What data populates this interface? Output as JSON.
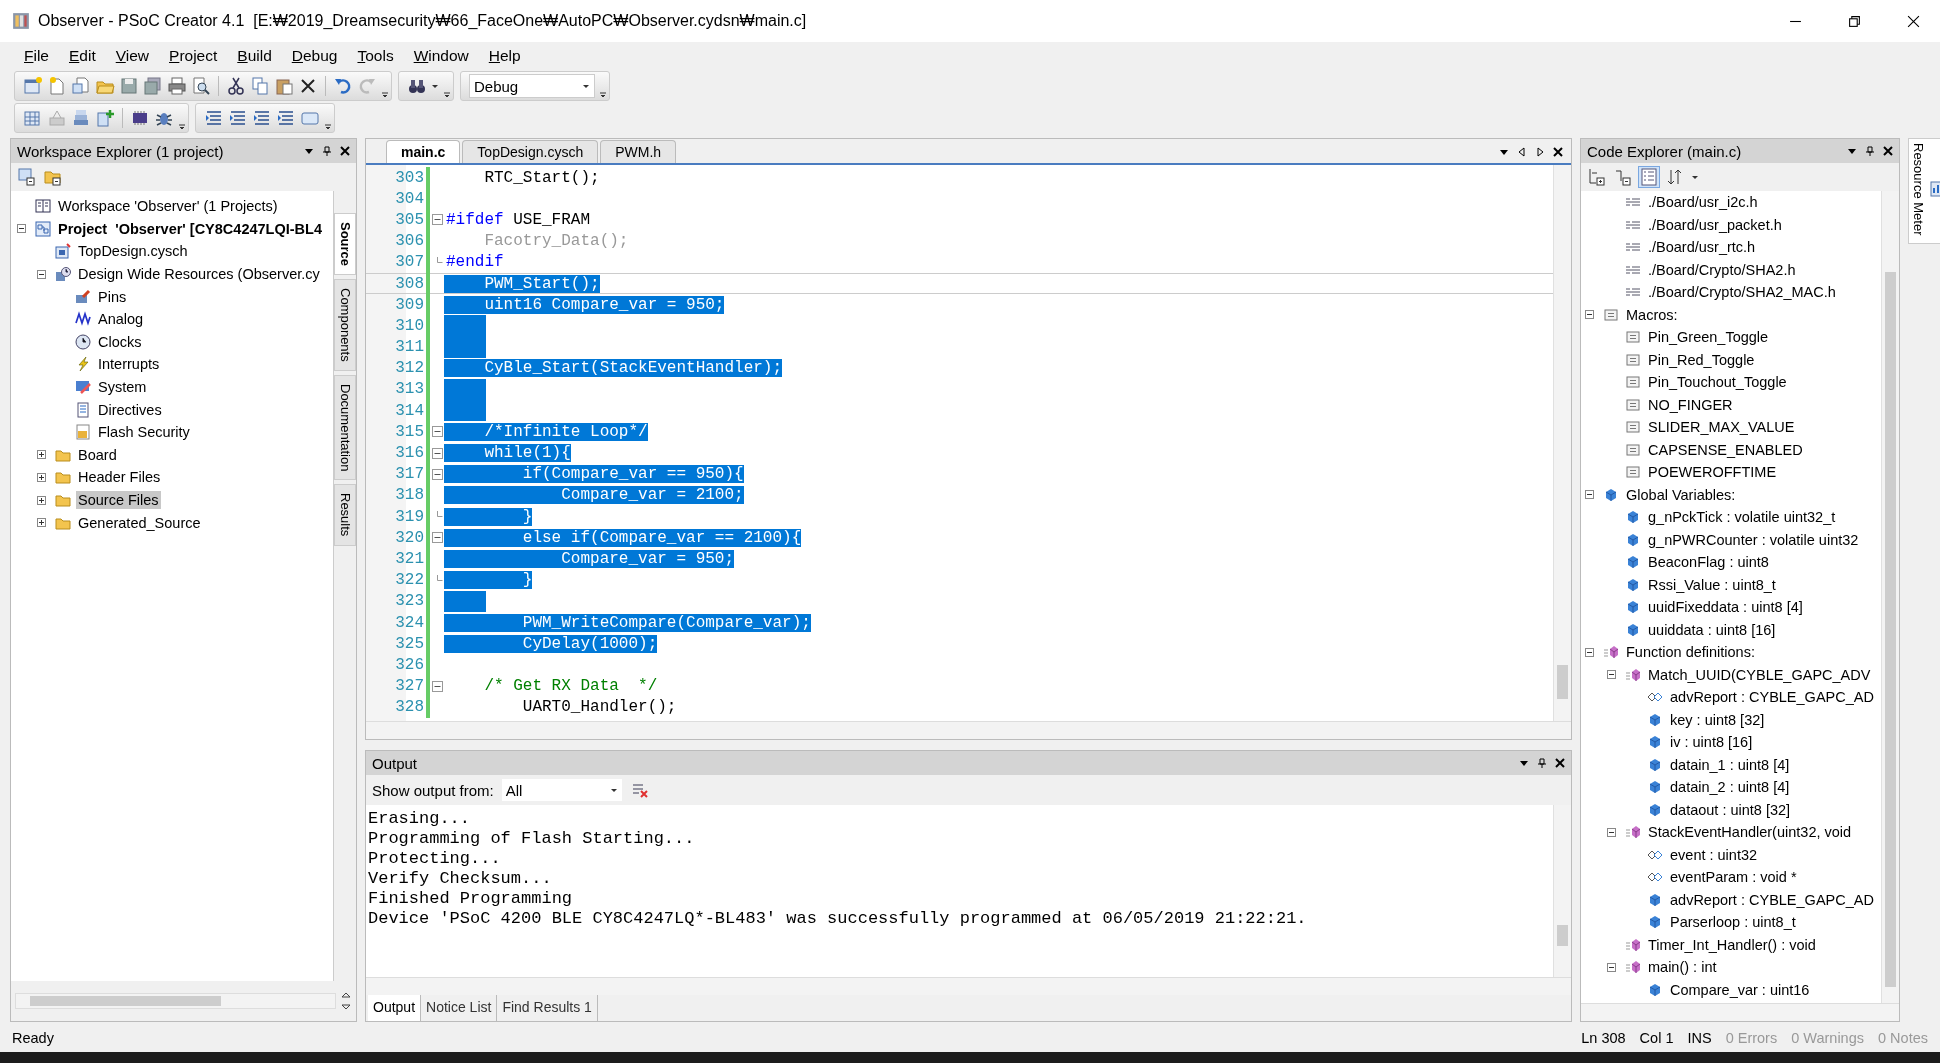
{
  "window": {
    "title": "Observer - PSoC Creator 4.1  [E:₩2019_Dreamsecurity₩66_FaceOne₩AutoPC₩Observer.cydsn₩main.c]"
  },
  "menu": [
    "File",
    "Edit",
    "View",
    "Project",
    "Build",
    "Debug",
    "Tools",
    "Window",
    "Help"
  ],
  "toolbar": {
    "configuration": "Debug"
  },
  "workspace_explorer": {
    "title": "Workspace Explorer (1 project)",
    "tree": [
      {
        "label": "Workspace 'Observer' (1 Projects)",
        "kind": "workspace",
        "selected": false
      },
      {
        "label": "Project  'Observer' [CY8C4247LQI-BL4",
        "kind": "project",
        "expanded": true,
        "selected": false,
        "children": [
          {
            "label": "TopDesign.cysch",
            "kind": "schematic",
            "selected": false
          },
          {
            "label": "Design Wide Resources (Observer.cy",
            "kind": "resources",
            "expanded": true,
            "selected": false,
            "children": [
              {
                "label": "Pins",
                "kind": "pins",
                "selected": false
              },
              {
                "label": "Analog",
                "kind": "analog",
                "selected": false
              },
              {
                "label": "Clocks",
                "kind": "clocks",
                "selected": false
              },
              {
                "label": "Interrupts",
                "kind": "interrupts",
                "selected": false
              },
              {
                "label": "System",
                "kind": "system",
                "selected": false
              },
              {
                "label": "Directives",
                "kind": "directives",
                "selected": false
              },
              {
                "label": "Flash Security",
                "kind": "security",
                "selected": false
              }
            ]
          },
          {
            "label": "Board",
            "kind": "folder",
            "expanded": false,
            "selected": false
          },
          {
            "label": "Header Files",
            "kind": "folder",
            "expanded": false,
            "selected": false
          },
          {
            "label": "Source Files",
            "kind": "folder",
            "expanded": false,
            "selected": true
          },
          {
            "label": "Generated_Source",
            "kind": "folder",
            "expanded": false,
            "selected": false
          }
        ]
      }
    ],
    "side_tabs": [
      {
        "label": "Source",
        "selected": true
      },
      {
        "label": "Components",
        "selected": false
      },
      {
        "label": "Documentation",
        "selected": false
      },
      {
        "label": "Results",
        "selected": false
      }
    ]
  },
  "editor": {
    "tabs": [
      {
        "label": "main.c",
        "selected": true
      },
      {
        "label": "TopDesign.cysch",
        "selected": false
      },
      {
        "label": "PWM.h",
        "selected": false
      }
    ],
    "lines": [
      {
        "num": "303",
        "kind": "code",
        "text": "    RTC_Start();",
        "collapsible": false,
        "block_end": false,
        "selected": false,
        "current": false
      },
      {
        "num": "304",
        "kind": "code",
        "collapsible": false,
        "block_end": false,
        "selected": false,
        "current": false
      },
      {
        "num": "305",
        "kind": "preproc",
        "directive": "#ifdef",
        "text": " USE_FRAM",
        "collapsible": true,
        "block_end": false,
        "selected": false,
        "current": false
      },
      {
        "num": "306",
        "kind": "inactive",
        "text": "    Facotry_Data();",
        "collapsible": false,
        "block_end": false,
        "selected": false,
        "current": false
      },
      {
        "num": "307",
        "kind": "preproc",
        "directive": "#endif",
        "collapsible": false,
        "block_end": true,
        "selected": false,
        "current": false
      },
      {
        "num": "308",
        "kind": "code",
        "text": "    PWM_Start();",
        "collapsible": false,
        "block_end": false,
        "selected": true,
        "current": true
      },
      {
        "num": "309",
        "kind": "code",
        "text": "    uint16 Compare_var = 950;",
        "collapsible": false,
        "block_end": false,
        "selected": true,
        "current": false
      },
      {
        "num": "310",
        "kind": "code",
        "collapsible": false,
        "block_end": false,
        "selected": true,
        "current": false
      },
      {
        "num": "311",
        "kind": "code",
        "collapsible": false,
        "block_end": false,
        "selected": true,
        "current": false
      },
      {
        "num": "312",
        "kind": "code",
        "text": "    CyBle_Start(StackEventHandler);",
        "collapsible": false,
        "block_end": false,
        "selected": true,
        "current": false
      },
      {
        "num": "313",
        "kind": "code",
        "collapsible": false,
        "block_end": false,
        "selected": true,
        "current": false
      },
      {
        "num": "314",
        "kind": "code",
        "collapsible": false,
        "block_end": false,
        "selected": true,
        "current": false
      },
      {
        "num": "315",
        "kind": "comment",
        "text": "    /*Infinite Loop*/",
        "collapsible": true,
        "block_end": false,
        "selected": true,
        "current": false
      },
      {
        "num": "316",
        "kind": "code",
        "text": "    while(1){",
        "collapsible": true,
        "block_end": false,
        "selected": true,
        "current": false
      },
      {
        "num": "317",
        "kind": "code",
        "text": "        if(Compare_var == 950){",
        "collapsible": true,
        "block_end": false,
        "selected": true,
        "current": false
      },
      {
        "num": "318",
        "kind": "code",
        "text": "            Compare_var = 2100;",
        "collapsible": false,
        "block_end": false,
        "selected": true,
        "current": false
      },
      {
        "num": "319",
        "kind": "code",
        "text": "        }",
        "collapsible": false,
        "block_end": true,
        "selected": true,
        "current": false
      },
      {
        "num": "320",
        "kind": "code",
        "text": "        else if(Compare_var == 2100){",
        "collapsible": true,
        "block_end": false,
        "selected": true,
        "current": false
      },
      {
        "num": "321",
        "kind": "code",
        "text": "            Compare_var = 950;",
        "collapsible": false,
        "block_end": false,
        "selected": true,
        "current": false
      },
      {
        "num": "322",
        "kind": "code",
        "text": "        }",
        "collapsible": false,
        "block_end": true,
        "selected": true,
        "current": false
      },
      {
        "num": "323",
        "kind": "code",
        "collapsible": false,
        "block_end": false,
        "selected": true,
        "current": false
      },
      {
        "num": "324",
        "kind": "code",
        "text": "        PWM_WriteCompare(Compare_var);",
        "collapsible": false,
        "block_end": false,
        "selected": true,
        "current": false
      },
      {
        "num": "325",
        "kind": "code",
        "text": "        CyDelay(1000);",
        "collapsible": false,
        "block_end": false,
        "selected": true,
        "current": false
      },
      {
        "num": "326",
        "kind": "code",
        "collapsible": false,
        "block_end": false,
        "selected": false,
        "current": false
      },
      {
        "num": "327",
        "kind": "comment",
        "text": "    /* Get RX Data  */",
        "collapsible": true,
        "block_end": false,
        "selected": false,
        "current": false
      },
      {
        "num": "328",
        "kind": "code",
        "text": "        UART0_Handler();",
        "collapsible": false,
        "block_end": false,
        "selected": false,
        "current": false
      }
    ]
  },
  "output": {
    "title": "Output",
    "filter_label": "Show output from:",
    "filter_value": "All",
    "lines": [
      "Erasing...",
      "Programming of Flash Starting...",
      "Protecting...",
      "Verify Checksum...",
      "Finished Programming",
      "Device 'PSoC 4200 BLE CY8C4247LQ*-BL483' was successfully programmed at 06/05/2019 21:22:21."
    ],
    "tabs": [
      {
        "label": "Output",
        "selected": true
      },
      {
        "label": "Notice List",
        "selected": false
      },
      {
        "label": "Find Results 1",
        "selected": false
      }
    ]
  },
  "code_explorer": {
    "title": "Code Explorer (main.c)",
    "include_items": [
      {
        "label": "./Board/usr_i2c.h",
        "kind": "include"
      },
      {
        "label": "./Board/usr_packet.h",
        "kind": "include"
      },
      {
        "label": "./Board/usr_rtc.h",
        "kind": "include"
      },
      {
        "label": "./Board/Crypto/SHA2.h",
        "kind": "include"
      },
      {
        "label": "./Board/Crypto/SHA2_MAC.h",
        "kind": "include"
      }
    ],
    "tree": [
      {
        "label": "Macros:",
        "kind": "macro",
        "expanded": true,
        "children": [
          {
            "label": "Pin_Green_Toggle",
            "kind": "macro"
          },
          {
            "label": "Pin_Red_Toggle",
            "kind": "macro"
          },
          {
            "label": "Pin_Touchout_Toggle",
            "kind": "macro"
          },
          {
            "label": "NO_FINGER",
            "kind": "macro"
          },
          {
            "label": "SLIDER_MAX_VALUE",
            "kind": "macro"
          },
          {
            "label": "CAPSENSE_ENABLED",
            "kind": "macro"
          },
          {
            "label": "POEWEROFFTIME",
            "kind": "macro"
          }
        ]
      },
      {
        "label": "Global Variables:",
        "kind": "variable",
        "expanded": true,
        "children": [
          {
            "label": "g_nPckTick : volatile uint32_t",
            "kind": "variable"
          },
          {
            "label": "g_nPWRCounter : volatile uint32",
            "kind": "variable"
          },
          {
            "label": "BeaconFlag : uint8",
            "kind": "variable"
          },
          {
            "label": "Rssi_Value : uint8_t",
            "kind": "variable"
          },
          {
            "label": "uuidFixeddata : uint8 [4]",
            "kind": "variable"
          },
          {
            "label": "uuiddata : uint8 [16]",
            "kind": "variable"
          }
        ]
      },
      {
        "label": "Function definitions:",
        "kind": "function",
        "expanded": true,
        "children": [
          {
            "label": "Match_UUID(CYBLE_GAPC_ADV",
            "kind": "function",
            "expanded": true,
            "children": [
              {
                "label": "advReport : CYBLE_GAPC_AD",
                "kind": "param"
              },
              {
                "label": "key : uint8 [32]",
                "kind": "variable"
              },
              {
                "label": "iv : uint8 [16]",
                "kind": "variable"
              },
              {
                "label": "datain_1 : uint8 [4]",
                "kind": "variable"
              },
              {
                "label": "datain_2 : uint8 [4]",
                "kind": "variable"
              },
              {
                "label": "dataout : uint8 [32]",
                "kind": "variable"
              }
            ]
          },
          {
            "label": "StackEventHandler(uint32, void",
            "kind": "function",
            "expanded": true,
            "children": [
              {
                "label": "event : uint32",
                "kind": "param"
              },
              {
                "label": "eventParam : void *",
                "kind": "param"
              },
              {
                "label": "advReport : CYBLE_GAPC_AD",
                "kind": "variable"
              },
              {
                "label": "Parserloop : uint8_t",
                "kind": "variable"
              }
            ]
          },
          {
            "label": "Timer_Int_Handler() : void",
            "kind": "function"
          },
          {
            "label": "main() : int",
            "kind": "function",
            "expanded": true,
            "children": [
              {
                "label": "Compare_var : uint16",
                "kind": "variable"
              }
            ]
          }
        ]
      }
    ]
  },
  "side_tab": {
    "label": "Resource Meter"
  },
  "status_bar": {
    "message": "Ready",
    "items": [
      {
        "text": "Ln 308",
        "disabled": false
      },
      {
        "text": "Col 1",
        "disabled": false
      },
      {
        "text": "INS",
        "disabled": false
      },
      {
        "text": "0 Errors",
        "disabled": true
      },
      {
        "text": "0 Warnings",
        "disabled": true
      },
      {
        "text": "0 Notes",
        "disabled": true
      }
    ]
  }
}
